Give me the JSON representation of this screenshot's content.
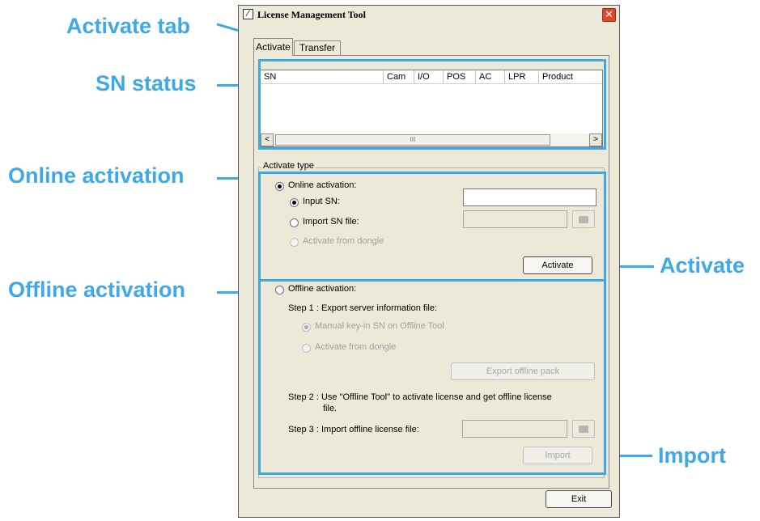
{
  "callouts": {
    "activate_tab": "Activate tab",
    "sn_status": "SN status",
    "online_activation": "Online activation",
    "offline_activation": "Offline activation",
    "activate": "Activate",
    "import": "Import"
  },
  "window": {
    "title": "License Management Tool",
    "close_icon": "close-icon",
    "app_icon": "app-icon"
  },
  "tabs": [
    {
      "label": "Activate",
      "active": true
    },
    {
      "label": "Transfer",
      "active": false
    }
  ],
  "sn_list": {
    "columns": [
      "SN",
      "Cam",
      "I/O",
      "POS",
      "AC",
      "LPR",
      "Product"
    ],
    "rows": [],
    "scroll_left_glyph": "<",
    "scroll_right_glyph": ">",
    "scroll_thumb_glyph": "III"
  },
  "activate_type": {
    "title": "Activate type",
    "online": {
      "label": "Online activation:",
      "selected": true,
      "input_sn_label": "Input SN:",
      "input_sn_value": "",
      "import_sn_file_label": "Import SN file:",
      "activate_from_dongle_label": "Activate from dongle",
      "activate_button": "Activate"
    },
    "offline": {
      "label": "Offline activation:",
      "selected": false,
      "step1": "Step 1 : Export server information file:",
      "manual_keyin_label": "Manual key-in SN on Offline Tool",
      "activate_from_dongle_label": "Activate from dongle",
      "export_button": "Export offline pack",
      "step2_line1": "Step 2 : Use \"Offline Tool\" to activate license and get offline license",
      "step2_line2": "file.",
      "step3": "Step 3 : Import offline license file:",
      "import_button": "Import"
    }
  },
  "footer": {
    "exit_button": "Exit"
  },
  "colors": {
    "callout": "#3fa9e8",
    "window_bg": "#ece9d8",
    "close_button": "#d84a2e"
  }
}
